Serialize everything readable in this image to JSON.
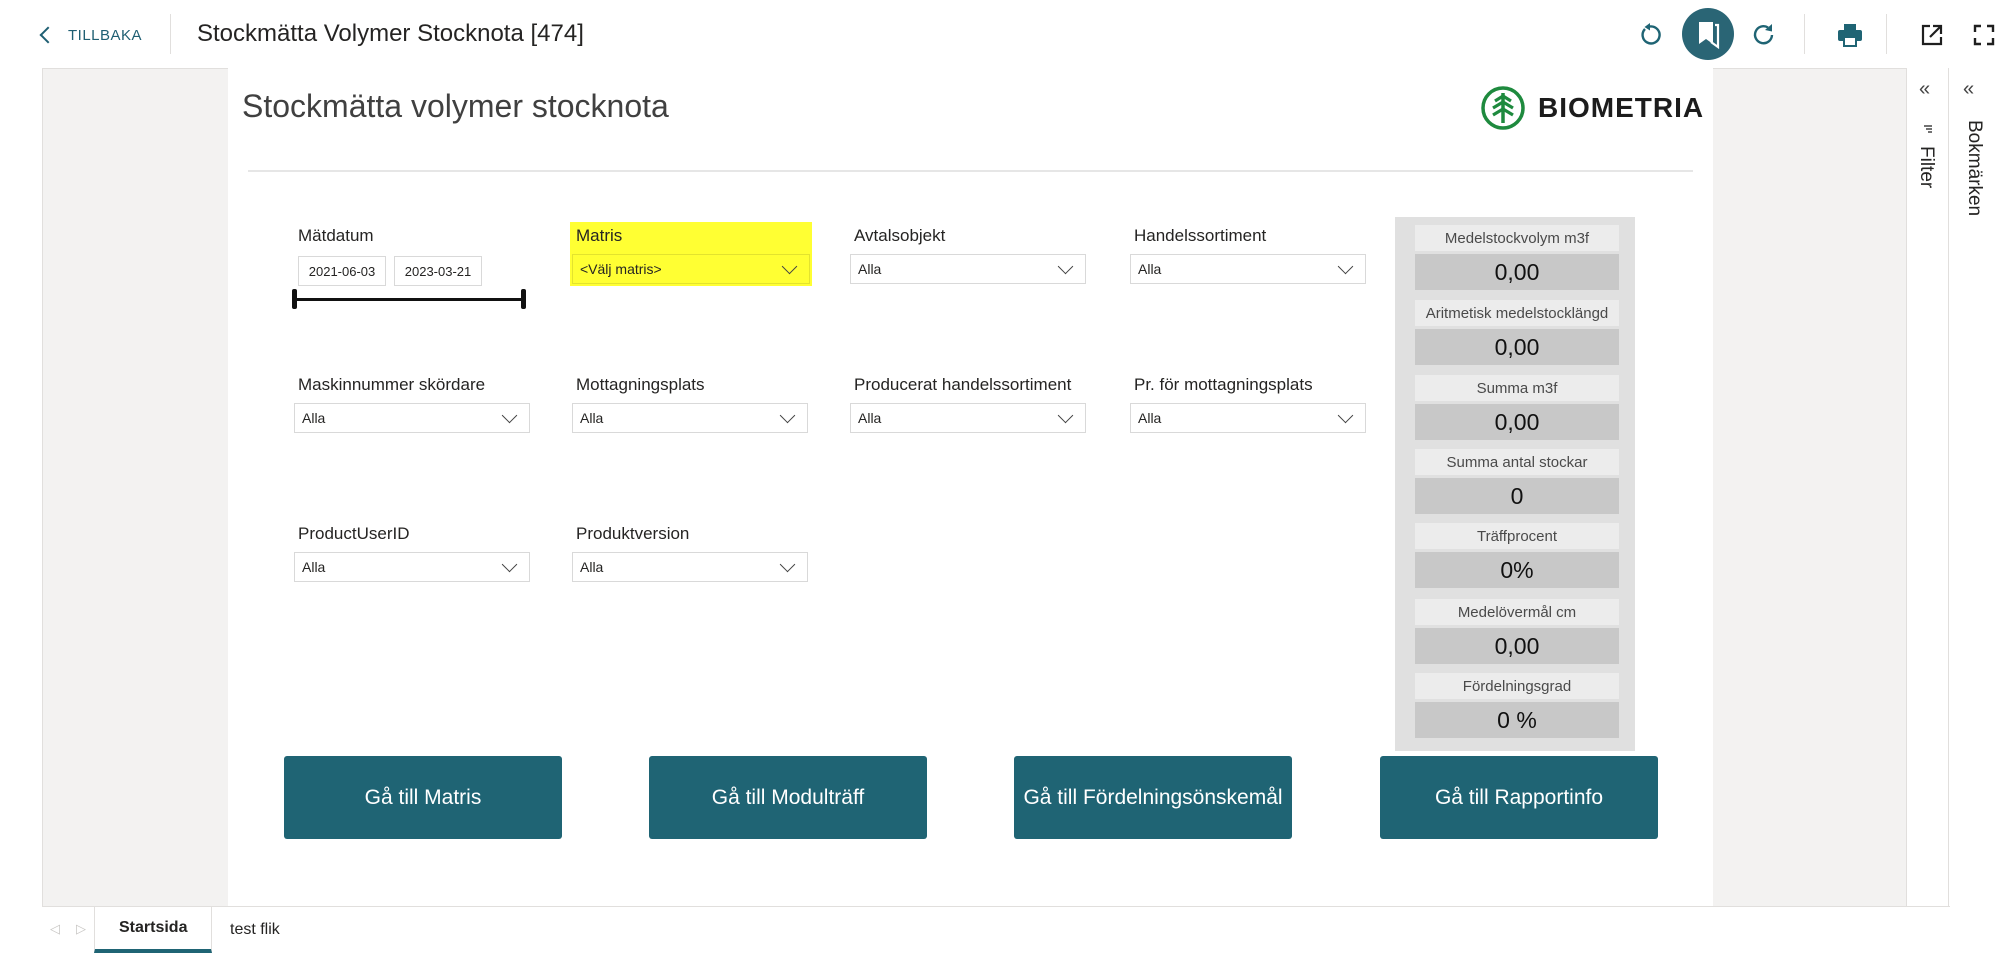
{
  "header": {
    "back_label": "TILLBAKA",
    "report_title": "Stockmätta Volymer Stocknota [474]",
    "icons": [
      "reset-icon",
      "bookmark-icon",
      "refresh-icon",
      "print-icon",
      "open-external-icon",
      "fullscreen-icon"
    ]
  },
  "canvas": {
    "title": "Stockmätta volymer stocknota",
    "logo_text": "BIOMETRIA",
    "brand_color": "#1f6474",
    "highlight_color": "#ffff33"
  },
  "slicers": {
    "matdatum": {
      "label": "Mätdatum",
      "from": "2021-06-03",
      "to": "2023-03-21"
    },
    "matris": {
      "label": "Matris",
      "value": "<Välj matris>"
    },
    "avtalsobjekt": {
      "label": "Avtalsobjekt",
      "value": "Alla"
    },
    "handelssortiment": {
      "label": "Handelssortiment",
      "value": "Alla"
    },
    "maskinnummer": {
      "label": "Maskinnummer skördare",
      "value": "Alla"
    },
    "mottagningsplats": {
      "label": "Mottagningsplats",
      "value": "Alla"
    },
    "producerat": {
      "label": "Producerat handelssortiment",
      "value": "Alla"
    },
    "pr_mottagningsplats": {
      "label": "Pr. för mottagningsplats",
      "value": "Alla"
    },
    "productuserid": {
      "label": "ProductUserID",
      "value": "Alla"
    },
    "produktversion": {
      "label": "Produktversion",
      "value": "Alla"
    }
  },
  "kpis": [
    {
      "label": "Medelstockvolym m3f",
      "value": "0,00"
    },
    {
      "label": "Aritmetisk medelstocklängd",
      "value": "0,00"
    },
    {
      "label": "Summa m3f",
      "value": "0,00"
    },
    {
      "label": "Summa antal stockar",
      "value": "0"
    },
    {
      "label": "Träffprocent",
      "value": "0%"
    },
    {
      "label": "Medelövermål cm",
      "value": "0,00"
    },
    {
      "label": "Fördelningsgrad",
      "value": "0 %"
    }
  ],
  "nav_buttons": {
    "matris": "Gå till Matris",
    "modultraff": "Gå till Modulträff",
    "fordelning": "Gå till Fördelningsönskemål",
    "rapportinfo": "Gå till Rapportinfo"
  },
  "panes": {
    "filter": "Filter",
    "bookmarks": "Bokmärken"
  },
  "tabs": [
    {
      "label": "Startsida",
      "active": true
    },
    {
      "label": "test flik",
      "active": false
    }
  ]
}
